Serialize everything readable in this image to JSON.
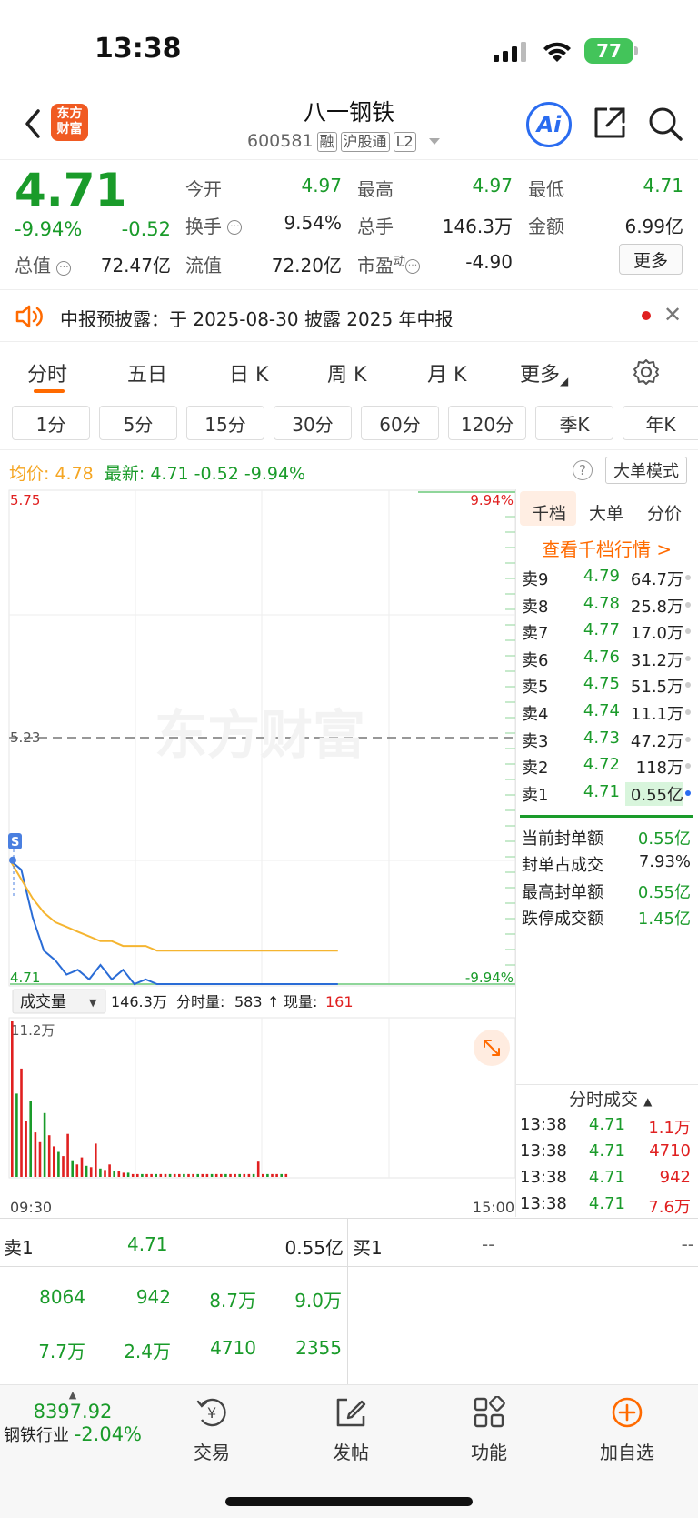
{
  "status_bar": {
    "time": "13:38",
    "battery": "77"
  },
  "header": {
    "stock_name": "八一钢铁",
    "stock_code": "600581",
    "tags": [
      "融",
      "沪股通",
      "L2"
    ],
    "logo_line1": "东方",
    "logo_line2": "财富",
    "ai_label": "Ai"
  },
  "quote": {
    "price": "4.71",
    "change_pct": "-9.94%",
    "change_amt": "-0.52",
    "total_value_label": "总值",
    "total_value": "72.47亿",
    "open_label": "今开",
    "open": "4.97",
    "high_label": "最高",
    "high": "4.97",
    "low_label": "最低",
    "low": "4.71",
    "turnover_label": "换手",
    "turnover": "9.54%",
    "volume_label": "总手",
    "volume": "146.3万",
    "amount_label": "金额",
    "amount": "6.99亿",
    "float_label": "流值",
    "float_value": "72.20亿",
    "pe_label": "市盈",
    "pe_sup": "动",
    "pe": "-4.90",
    "more_label": "更多"
  },
  "notice": {
    "text": "中报预披露：于 2025-08-30 披露 2025 年中报"
  },
  "tabs": [
    "分时",
    "五日",
    "日 K",
    "周 K",
    "月 K",
    "更多"
  ],
  "periods": [
    "1分",
    "5分",
    "15分",
    "30分",
    "60分",
    "120分",
    "季K",
    "年K"
  ],
  "chart_header": {
    "avg_label": "均价:",
    "avg": "4.78",
    "latest_label": "最新:",
    "latest": "4.71",
    "latest_chg": "-0.52",
    "latest_pct": "-9.94%",
    "help": "?",
    "big_order_mode": "大单模式"
  },
  "chart": {
    "y_top": "5.75",
    "y_mid": "5.23",
    "y_bottom": "4.71",
    "pct_top": "9.94%",
    "pct_bottom": "-9.94%",
    "watermark": "东方财富",
    "s_marker": "S",
    "volume_selector": "成交量",
    "volume_total": "146.3万",
    "volume_info_label1": "分时量:",
    "volume_info_val1": "583",
    "volume_info_label2": "现量:",
    "volume_info_val2": "161",
    "vol_max": "11.2万",
    "time_start": "09:30",
    "time_end": "15:00"
  },
  "chart_data": {
    "type": "line",
    "title": "",
    "xlabel": "",
    "ylabel": "",
    "ylim": [
      4.71,
      5.75
    ],
    "x_range": [
      "09:30",
      "15:00"
    ],
    "series": [
      {
        "name": "",
        "color": "#2a6cd6",
        "values": [
          4.97,
          4.95,
          4.85,
          4.78,
          4.76,
          4.73,
          4.74,
          4.72,
          4.75,
          4.72,
          4.74,
          4.71,
          4.72,
          4.71,
          4.71,
          4.71,
          4.71,
          4.71,
          4.71,
          4.71,
          4.71,
          4.71,
          4.71,
          4.71,
          4.71,
          4.71,
          4.71,
          4.71,
          4.71,
          4.71
        ]
      },
      {
        "name": "",
        "color": "#f5b531",
        "values": [
          4.97,
          4.93,
          4.89,
          4.86,
          4.84,
          4.83,
          4.82,
          4.81,
          4.8,
          4.8,
          4.79,
          4.79,
          4.79,
          4.78,
          4.78,
          4.78,
          4.78,
          4.78,
          4.78,
          4.78,
          4.78,
          4.78,
          4.78,
          4.78,
          4.78,
          4.78,
          4.78,
          4.78,
          4.78,
          4.78
        ]
      }
    ],
    "volume": {
      "ylim": [
        0,
        11.2
      ],
      "values": [
        11.2,
        6.0,
        7.8,
        4.0,
        5.5,
        3.2,
        2.5,
        4.6,
        3.0,
        2.2,
        1.8,
        1.5,
        3.1,
        1.2,
        0.9,
        1.4,
        0.8,
        0.7,
        2.4,
        0.6,
        0.5,
        0.9,
        0.4,
        0.4,
        0.3,
        0.3,
        0.2,
        0.2,
        0.2,
        0.2,
        0.2,
        0.2,
        0.2,
        0.2,
        0.2,
        0.2,
        0.2,
        0.2,
        0.2,
        0.2,
        0.2,
        0.2,
        0.2,
        0.2,
        0.2,
        0.2,
        0.2,
        0.2,
        0.2,
        0.2,
        0.2,
        0.2,
        0.2,
        1.1,
        0.2,
        0.2,
        0.2,
        0.2,
        0.2,
        0.2
      ],
      "up_color": "#e02020",
      "down_color": "#1a9b2a"
    }
  },
  "order_book": {
    "tabs": [
      "千档",
      "大单",
      "分价"
    ],
    "link": "查看千档行情 >",
    "asks": [
      {
        "label": "卖9",
        "price": "4.79",
        "vol": "64.7万"
      },
      {
        "label": "卖8",
        "price": "4.78",
        "vol": "25.8万"
      },
      {
        "label": "卖7",
        "price": "4.77",
        "vol": "17.0万"
      },
      {
        "label": "卖6",
        "price": "4.76",
        "vol": "31.2万"
      },
      {
        "label": "卖5",
        "price": "4.75",
        "vol": "51.5万"
      },
      {
        "label": "卖4",
        "price": "4.74",
        "vol": "11.1万"
      },
      {
        "label": "卖3",
        "price": "4.73",
        "vol": "47.2万"
      },
      {
        "label": "卖2",
        "price": "4.72",
        "vol": "118万"
      },
      {
        "label": "卖1",
        "price": "4.71",
        "vol": "0.55亿"
      }
    ],
    "seal": [
      {
        "label": "当前封单额",
        "value": "0.55亿"
      },
      {
        "label": "封单占成交",
        "value": "7.93%"
      },
      {
        "label": "最高封单额",
        "value": "0.55亿"
      },
      {
        "label": "跌停成交额",
        "value": "1.45亿"
      }
    ]
  },
  "trades": {
    "title": "分时成交",
    "rows": [
      {
        "time": "13:38",
        "price": "4.71",
        "vol": "1.1万"
      },
      {
        "time": "13:38",
        "price": "4.71",
        "vol": "4710"
      },
      {
        "time": "13:38",
        "price": "4.71",
        "vol": "942"
      },
      {
        "time": "13:38",
        "price": "4.71",
        "vol": "7.6万"
      }
    ]
  },
  "depth": {
    "sell1_label": "卖1",
    "sell1_price": "4.71",
    "sell1_vol": "0.55亿",
    "buy1_label": "买1",
    "buy1_price": "--",
    "buy1_vol": "--",
    "row1": [
      "8064",
      "942",
      "8.7万",
      "9.0万"
    ],
    "row2": [
      "7.7万",
      "2.4万",
      "4710",
      "2355"
    ]
  },
  "bottom_nav": {
    "index_value": "8397.92",
    "index_name": "钢铁行业",
    "index_pct": "-2.04%",
    "items": [
      "交易",
      "发帖",
      "功能",
      "加自选"
    ]
  }
}
